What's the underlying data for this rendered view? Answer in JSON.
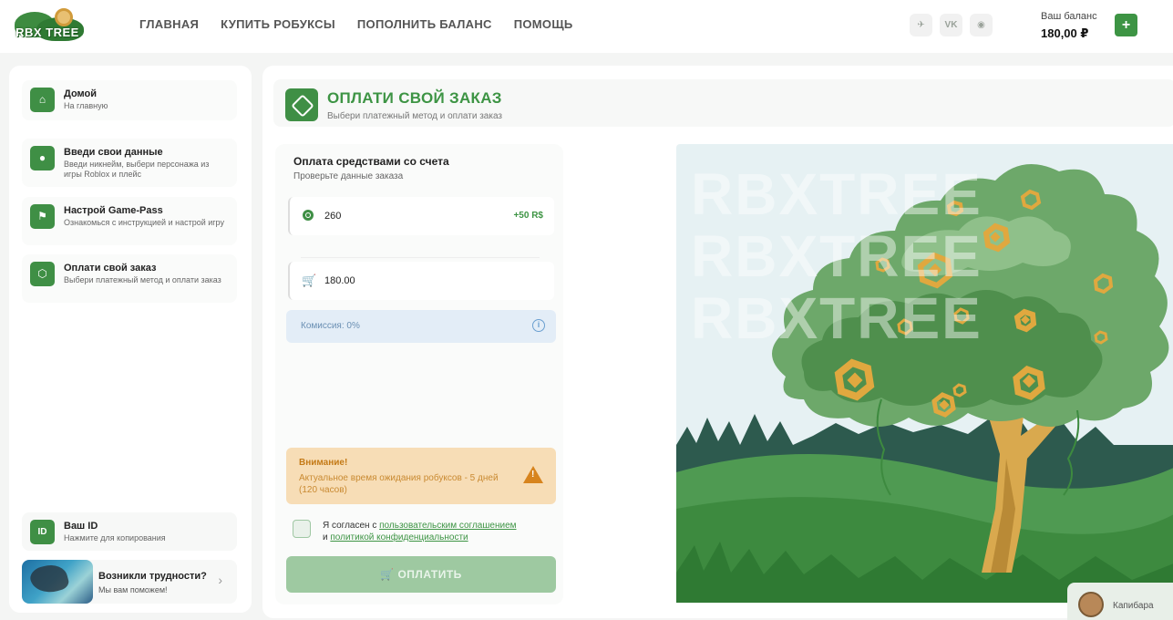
{
  "header": {
    "logo_text": "RBX TREE",
    "nav": [
      "ГЛАВНАЯ",
      "КУПИТЬ РОБУКСЫ",
      "ПОПОЛНИТЬ БАЛАНС",
      "ПОМОЩЬ"
    ],
    "socials": [
      {
        "icon": "telegram-icon",
        "glyph": "✈"
      },
      {
        "icon": "vk-icon",
        "glyph": "VK"
      },
      {
        "icon": "discord-icon",
        "glyph": "◉"
      }
    ],
    "balance_label": "Ваш баланс",
    "balance_value": "180,00 ₽",
    "add_label": "+"
  },
  "sidebar": {
    "items": [
      {
        "title": "Домой",
        "subtitle": "На главную",
        "icon": "home-icon",
        "glyph": "⌂"
      },
      {
        "title": "Введи свои данные",
        "subtitle": "Введи никнейм, выбери персонажа из игры Roblox и плейс",
        "icon": "user-icon",
        "glyph": "●"
      },
      {
        "title": "Настрой Game-Pass",
        "subtitle": "Ознакомься с инструкцией и настрой игру",
        "icon": "map-pin-icon",
        "glyph": "⚑"
      },
      {
        "title": "Оплати свой заказ",
        "subtitle": "Выбери платежный метод и оплати заказ",
        "icon": "robux-icon",
        "glyph": "⬡"
      }
    ],
    "id_item": {
      "title": "Ваш ID",
      "subtitle": "Нажмите для копирования",
      "glyph": "ID"
    },
    "help": {
      "title": "Возникли трудности?",
      "subtitle": "Мы вам поможем!",
      "chevron": "›"
    }
  },
  "main": {
    "title": "ОПЛАТИ СВОЙ ЗАКАЗ",
    "subtitle": "Выбери платежный метод и оплати заказ"
  },
  "payment": {
    "title": "Оплата средствами со счета",
    "subtitle": "Проверьте данные заказа",
    "robux_amount": "260",
    "robux_bonus": "+50 R$",
    "price": "180.00",
    "commission": "Комиссия: 0%",
    "info_glyph": "i",
    "warning_title": "Внимание!",
    "warning_text": "Актуальное время ожидания робуксов - 5 дней (120 часов)",
    "warning_glyph": "!",
    "agree_prefix": "Я согласен с ",
    "agree_link1": "пользовательским соглашением",
    "agree_mid": " и ",
    "agree_link2": "политикой конфиденциальности",
    "pay_button": "🛒  ОПЛАТИТЬ"
  },
  "illustration": {
    "watermark": [
      "RBXTREE",
      "RBXTREE",
      "RBXTREE"
    ],
    "colors": {
      "sky": "#e6f1f3",
      "forest": "#2d5a4e",
      "grass": "#3f8f3f",
      "tree": "#6da86a",
      "trunk": "#d9a94e",
      "coin": "#e0a83f"
    }
  },
  "chat": {
    "name": "Капибара"
  }
}
